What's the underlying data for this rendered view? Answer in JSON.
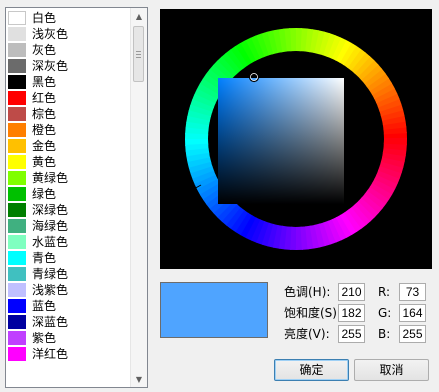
{
  "colors": [
    {
      "label": "白色",
      "hex": "#ffffff"
    },
    {
      "label": "浅灰色",
      "hex": "#e0e0e0"
    },
    {
      "label": "灰色",
      "hex": "#bdbdbd"
    },
    {
      "label": "深灰色",
      "hex": "#6b6b6b"
    },
    {
      "label": "黑色",
      "hex": "#000000"
    },
    {
      "label": "红色",
      "hex": "#ff0000"
    },
    {
      "label": "棕色",
      "hex": "#be4b48"
    },
    {
      "label": "橙色",
      "hex": "#ff7f00"
    },
    {
      "label": "金色",
      "hex": "#ffc000"
    },
    {
      "label": "黄色",
      "hex": "#ffff00"
    },
    {
      "label": "黄绿色",
      "hex": "#80ff00"
    },
    {
      "label": "绿色",
      "hex": "#00c000"
    },
    {
      "label": "深绿色",
      "hex": "#007f00"
    },
    {
      "label": "海绿色",
      "hex": "#40b080"
    },
    {
      "label": "水蓝色",
      "hex": "#7fffc0"
    },
    {
      "label": "青色",
      "hex": "#00ffff"
    },
    {
      "label": "青绿色",
      "hex": "#40c0c0"
    },
    {
      "label": "浅紫色",
      "hex": "#c0c0ff"
    },
    {
      "label": "蓝色",
      "hex": "#0000ff"
    },
    {
      "label": "深蓝色",
      "hex": "#0000a0"
    },
    {
      "label": "紫色",
      "hex": "#c040ff"
    },
    {
      "label": "洋红色",
      "hex": "#ff00ff"
    }
  ],
  "selected_color_hex": "#4fa4ff",
  "hsv": {
    "hue_label": "色调(H):",
    "hue": "210",
    "sat_label": "饱和度(S):",
    "sat": "182",
    "val_label": "亮度(V):",
    "val": "255"
  },
  "rgb": {
    "r_label": "R:",
    "r": "73",
    "g_label": "G:",
    "g": "164",
    "b_label": "B:",
    "b": "255"
  },
  "buttons": {
    "ok": "确定",
    "cancel": "取消"
  },
  "icons": {
    "scroll_up": "arrow-up-icon",
    "scroll_down": "arrow-down-icon"
  }
}
